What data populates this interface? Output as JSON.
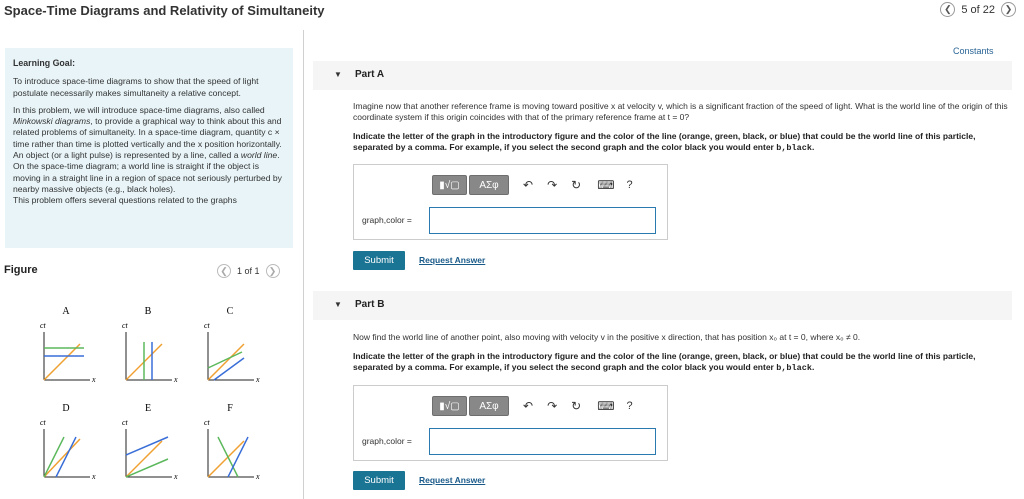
{
  "header": {
    "title": "Space-Time Diagrams and Relativity of Simultaneity",
    "pager_text": "5 of 22"
  },
  "learning_goal": {
    "heading": "Learning Goal:",
    "p1": "To introduce space-time diagrams to show that the speed of light postulate necessarily makes simultaneity a relative concept.",
    "p2a": "In this problem, we will introduce space-time diagrams, also called ",
    "p2b": "Minkowski diagrams",
    "p2c": ", to provide a graphical way to think about this and related problems of simultaneity. In a space-time diagram, quantity c × time rather than time is plotted vertically and the x position horizontally.",
    "p3a": "An object (or a light pulse) is represented by a line, called a ",
    "p3b": "world line",
    "p3c": ". On the space-time diagram; a world line is straight if the object is moving in a straight line in a region of space not seriously perturbed by nearby massive objects (e.g., black holes).",
    "p4": "This problem offers several questions related to the graphs"
  },
  "figure": {
    "title": "Figure",
    "pager_text": "1 of 1",
    "panels": [
      {
        "label": "A"
      },
      {
        "label": "B"
      },
      {
        "label": "C"
      },
      {
        "label": "D"
      },
      {
        "label": "E"
      },
      {
        "label": "F"
      }
    ],
    "axis_y": "ct",
    "axis_x": "x"
  },
  "colors": {
    "orange": "#f0a030",
    "green": "#5cb85c",
    "blue": "#3a6fd8",
    "black": "#222222",
    "submit": "#1a7494",
    "link": "#1a5a8a"
  },
  "constants_link": "Constants",
  "partA": {
    "label": "Part A",
    "q1": "Imagine now that another reference frame is moving toward positive x at velocity v, which is a significant fraction of the speed of light. What is the world line of the origin of this coordinate system if this origin coincides with that of the primary reference frame at t = 0?",
    "q2": "Indicate the letter of the graph in the introductory figure and the color of the line (orange, green, black, or blue) that could be the world line of this particle, separated by a comma. For example, if you select the second graph and the color black you would enter ",
    "q2_example": "b,black",
    "field_label": "graph,color =",
    "field_value": "",
    "submit": "Submit",
    "request": "Request Answer"
  },
  "partB": {
    "label": "Part B",
    "q1": "Now find the world line of another point, also moving with velocity v in the positive x direction, that has position x₀ at t = 0, where x₀ ≠ 0.",
    "q2": "Indicate the letter of the graph in the introductory figure and the color of the line (orange, green, black, or blue) that could be the world line of this particle, separated by a comma. For example, if you select the second graph and the color black you would enter ",
    "q2_example": "b,black",
    "field_label": "graph,color =",
    "field_value": "",
    "submit": "Submit",
    "request": "Request Answer"
  },
  "toolbar": {
    "btn_templates": "▮√▢",
    "btn_symbols": "ΑΣφ",
    "undo": "↶",
    "redo": "↷",
    "reset": "↻",
    "keyboard": "⌨",
    "help": "?"
  }
}
